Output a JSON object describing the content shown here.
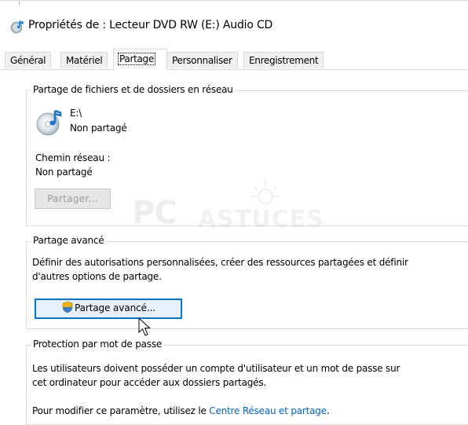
{
  "window": {
    "title": "Propriétés de : Lecteur DVD RW (E:) Audio CD"
  },
  "tabs": [
    {
      "label": "Général",
      "active": false
    },
    {
      "label": "Matériel",
      "active": false
    },
    {
      "label": "Partage",
      "active": true
    },
    {
      "label": "Personnaliser",
      "active": false
    },
    {
      "label": "Enregistrement",
      "active": false
    }
  ],
  "network_sharing": {
    "legend": "Partage de fichiers et de dossiers en réseau",
    "drive": "E:\\",
    "status": "Non partagé",
    "path_label": "Chemin réseau :",
    "path_value": "Non partagé",
    "share_button": "Partager..."
  },
  "advanced_sharing": {
    "legend": "Partage avancé",
    "description_line1": "Définir des autorisations personnalisées, créer des ressources partagées et définir",
    "description_line2": "d'autres options de partage.",
    "button": "Partage avancé..."
  },
  "password_protection": {
    "legend": "Protection par mot de passe",
    "line1": "Les utilisateurs doivent posséder un compte d'utilisateur et un mot de passe sur",
    "line2": "cet ordinateur pour accéder aux dossiers partagés.",
    "line3_prefix": "Pour modifier ce paramètre, utilisez le ",
    "line3_link": "Centre Réseau et partage",
    "line3_suffix": "."
  },
  "watermark": {
    "brand_pc": "PC",
    "brand_rest": "ASTUCES"
  },
  "colors": {
    "accent": "#0078d7",
    "link": "#0066cc",
    "border": "#d9d9d9",
    "tab_bg": "#f0f0f0"
  }
}
